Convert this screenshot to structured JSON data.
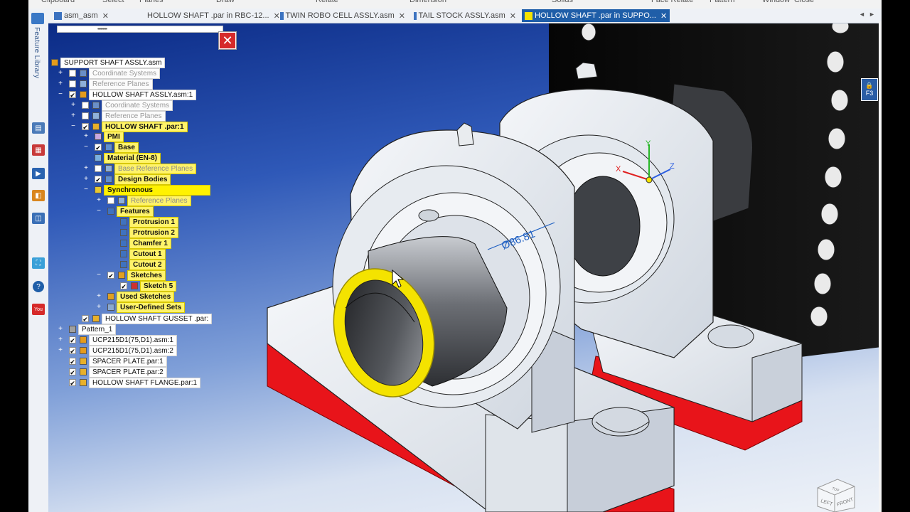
{
  "ribbon": {
    "items": [
      "Clipboard",
      "Select",
      "Planes",
      "Draw",
      "Relate",
      "Dimension",
      "Solids",
      "Face Relate",
      "Pattern",
      "Window",
      "Close"
    ]
  },
  "tabs": [
    {
      "label": "asm_asm",
      "close": "✕",
      "active": false
    },
    {
      "label": "HOLLOW SHAFT .par in RBC-12...",
      "close": "✕",
      "active": false
    },
    {
      "label": "TWIN ROBO CELL ASSLY.asm",
      "close": "✕",
      "active": false
    },
    {
      "label": "TAIL STOCK ASSLY.asm",
      "close": "✕",
      "active": false
    },
    {
      "label": "HOLLOW SHAFT .par in SUPPO...",
      "close": "✕",
      "active": true
    }
  ],
  "tab_nav": {
    "prev": "◄",
    "next": "►"
  },
  "left_bar": {
    "feature_library_label": "Feature Library",
    "icons": [
      "layers-icon",
      "color-icon",
      "media-icon",
      "sensor-icon",
      "selection-icon",
      "library-icon",
      "help-icon",
      "youtube-icon"
    ]
  },
  "tree": {
    "grip": "•••••••••",
    "close_glyph": "✕",
    "rows": [
      {
        "label": "SUPPORT SHAFT ASSLY.asm",
        "exp": "",
        "chk": "",
        "style": "normal",
        "icon": "assembly-icon"
      },
      {
        "label": "Coordinate Systems",
        "exp": "+",
        "chk": " ",
        "style": "dim",
        "icon": "coordinate-icon"
      },
      {
        "label": "Reference Planes",
        "exp": "+",
        "chk": " ",
        "style": "dim",
        "icon": "plane-icon"
      },
      {
        "label": "HOLLOW SHAFT ASSLY.asm:1",
        "exp": "−",
        "chk": "✔",
        "style": "normal",
        "icon": "assembly-icon"
      },
      {
        "label": "Coordinate Systems",
        "exp": "+",
        "chk": " ",
        "style": "dim",
        "icon": "coordinate-icon"
      },
      {
        "label": "Reference Planes",
        "exp": "+",
        "chk": " ",
        "style": "dim",
        "icon": "plane-icon"
      },
      {
        "label": "HOLLOW SHAFT .par:1",
        "exp": "−",
        "chk": "✔",
        "style": "yel",
        "icon": "part-icon"
      },
      {
        "label": "PMI",
        "exp": "+",
        "chk": "",
        "style": "yel",
        "icon": "pmi-icon"
      },
      {
        "label": "Base",
        "exp": "−",
        "chk": "✔",
        "style": "yel",
        "icon": "base-icon"
      },
      {
        "label": "Material (EN-8)",
        "exp": "",
        "chk": "",
        "style": "yel",
        "icon": "material-icon"
      },
      {
        "label": "Base Reference Planes",
        "exp": "+",
        "chk": " ",
        "style": "dimyel",
        "icon": "plane-icon"
      },
      {
        "label": "Design Bodies",
        "exp": "+",
        "chk": "✔",
        "style": "yel",
        "icon": "body-icon"
      },
      {
        "label": "Synchronous",
        "exp": "−",
        "chk": "",
        "style": "yel",
        "icon": "sync-icon"
      },
      {
        "label": "Reference Planes",
        "exp": "+",
        "chk": " ",
        "style": "dimyel",
        "icon": "plane-icon"
      },
      {
        "label": "Features",
        "exp": "−",
        "chk": "",
        "style": "yel",
        "icon": "features-icon"
      },
      {
        "label": "Protrusion 1",
        "exp": "",
        "chk": "",
        "style": "yel",
        "icon": "protrusion-icon"
      },
      {
        "label": "Protrusion 2",
        "exp": "",
        "chk": "",
        "style": "yel",
        "icon": "protrusion-icon"
      },
      {
        "label": "Chamfer 1",
        "exp": "",
        "chk": "",
        "style": "yel",
        "icon": "chamfer-icon"
      },
      {
        "label": "Cutout 1",
        "exp": "",
        "chk": "",
        "style": "yel",
        "icon": "cutout-icon"
      },
      {
        "label": "Cutout 2",
        "exp": "",
        "chk": "",
        "style": "yel",
        "icon": "cutout-icon"
      },
      {
        "label": "Sketches",
        "exp": "−",
        "chk": "✔",
        "style": "yel",
        "icon": "sketches-icon"
      },
      {
        "label": "Sketch 5",
        "exp": "",
        "chk": "✔",
        "style": "yel",
        "icon": "sketch-icon"
      },
      {
        "label": "Used Sketches",
        "exp": "+",
        "chk": "",
        "style": "yel",
        "icon": "sketches-icon"
      },
      {
        "label": "User-Defined Sets",
        "exp": "+",
        "chk": "",
        "style": "yel",
        "icon": "sets-icon"
      },
      {
        "label": "HOLLOW SHAFT GUSSET .par:",
        "exp": "",
        "chk": "✔",
        "style": "normal",
        "icon": "part-icon"
      },
      {
        "label": "Pattern_1",
        "exp": "+",
        "chk": "",
        "style": "normal",
        "icon": "pattern-icon"
      },
      {
        "label": "UCP215D1(75,D1).asm:1",
        "exp": "+",
        "chk": "✔",
        "style": "normal",
        "icon": "assembly-icon"
      },
      {
        "label": "UCP215D1(75,D1).asm:2",
        "exp": "+",
        "chk": "✔",
        "style": "normal",
        "icon": "assembly-icon"
      },
      {
        "label": "SPACER PLATE.par:1",
        "exp": "",
        "chk": "✔",
        "style": "normal",
        "icon": "part-icon"
      },
      {
        "label": "SPACER PLATE.par:2",
        "exp": "",
        "chk": "✔",
        "style": "normal",
        "icon": "part-icon"
      },
      {
        "label": "HOLLOW SHAFT FLANGE.par:1",
        "exp": "",
        "chk": "✔",
        "style": "normal",
        "icon": "part-icon"
      }
    ]
  },
  "viewport": {
    "dimension_label": "Ø86.81",
    "triad": {
      "x": "X",
      "y": "Y",
      "z": "Z"
    },
    "lock_label": "F3",
    "viewcube": {
      "front": "FRONT",
      "left": "LEFT",
      "top": "TOP"
    }
  },
  "colors": {
    "selection": "#f4e300",
    "base_plate": "#e8141a",
    "active_tab": "#1f5ea8",
    "close_button": "#d62a2a"
  }
}
